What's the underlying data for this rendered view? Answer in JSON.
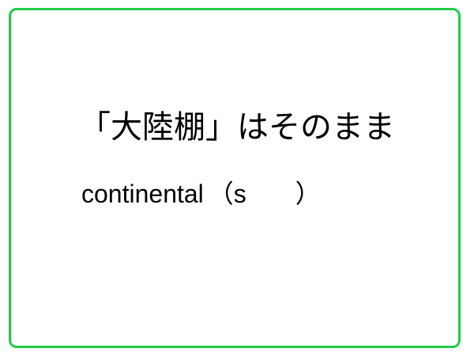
{
  "card": {
    "border_color": "#22c94a"
  },
  "prompt": {
    "instruction": "「大陸棚」はそのまま",
    "word": "continental",
    "paren_open": "（",
    "hint_letter": "s",
    "paren_close": "）"
  }
}
